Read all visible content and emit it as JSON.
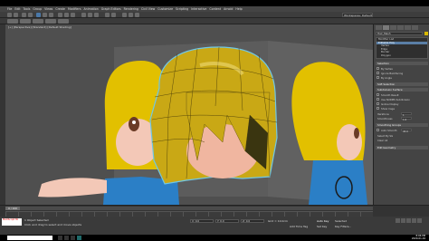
{
  "app": {
    "title": "Untitled - Autodesk 3ds Max 2020",
    "workspace_label": "Workspaces:",
    "workspace_value": "Default"
  },
  "menu": [
    "File",
    "Edit",
    "Tools",
    "Group",
    "Views",
    "Create",
    "Modifiers",
    "Animation",
    "Graph Editors",
    "Rendering",
    "Civil View",
    "Customize",
    "Scripting",
    "Interactive",
    "Content",
    "Arnold",
    "Help"
  ],
  "viewport": {
    "label": "[+] [Perspective] [Standard] [Default Shading]"
  },
  "command_panel": {
    "object_name": "Hair_Mesh",
    "modifier_list_label": "Modifier List",
    "stack": [
      {
        "label": "Editable Poly",
        "selected": true,
        "sub": false
      },
      {
        "label": "Vertex",
        "selected": false,
        "sub": true
      },
      {
        "label": "Edge",
        "selected": false,
        "sub": true
      },
      {
        "label": "Border",
        "selected": false,
        "sub": true
      },
      {
        "label": "Polygon",
        "selected": false,
        "sub": true
      },
      {
        "label": "Element",
        "selected": false,
        "sub": true
      }
    ],
    "sections": {
      "selection": "Selection",
      "soft_selection": "Soft Selection",
      "edit_geometry": "Edit Geometry",
      "subdivision": "Subdivision Surface",
      "smoothing": "Smoothing Groups",
      "polygon_props": "Edit Poly"
    },
    "options": {
      "by_vertex": "By Vertex",
      "ignore_backfacing": "Ignore Backfacing",
      "by_angle": "By Angle",
      "smooth_result": "Smooth Result",
      "use_nurms": "Use NURMS Subdivision",
      "isoline_display": "Isoline Display",
      "show_cage": "Show Cage",
      "iterations_label": "Iterations",
      "iterations_value": "1",
      "smoothness_label": "Smoothness",
      "smoothness_value": "1.0",
      "auto_smooth": "Auto Smooth",
      "auto_smooth_value": "45.0",
      "clear_all": "Clear All",
      "select_by_sg": "Select By SG"
    }
  },
  "timeline": {
    "frame_label": "0 / 100"
  },
  "status": {
    "maxscript": "MAXScript Mi",
    "selected": "1 Object Selected",
    "prompt": "Click and drag to select and move objects",
    "x": "X: 0.0",
    "y": "Y: 0.0",
    "z": "Z: 0.0",
    "grid": "Grid = 10.0cm",
    "add_time_tag": "Add Time Tag",
    "autokey": "Auto Key",
    "selected_dd": "Selected",
    "setkey": "Set Key",
    "key_filters": "Key Filters..."
  },
  "taskbar": {
    "time": "8:06 PM",
    "date": "2020-01-04"
  },
  "colors": {
    "hair": "#d7b800",
    "wireframe": "#6fc7e6",
    "skin": "#f0b6a0",
    "shirt": "#2b7fc6",
    "viewport_bg": "#4f4f4f"
  }
}
